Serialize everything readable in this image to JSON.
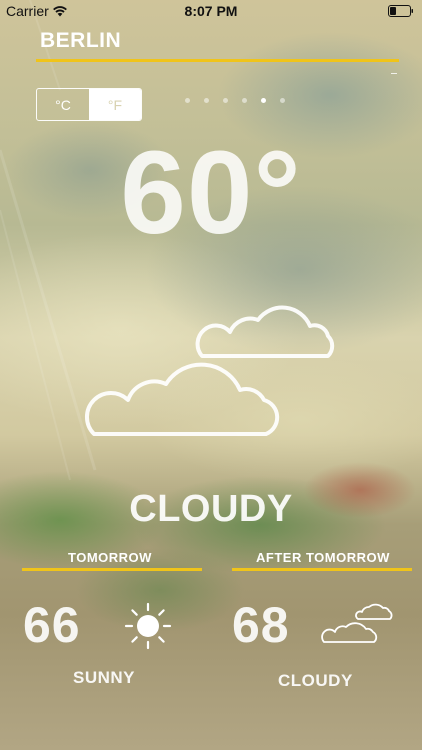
{
  "status_bar": {
    "carrier": "Carrier",
    "time": "8:07 PM"
  },
  "city": {
    "name": "BERLIN"
  },
  "unit_toggle": {
    "celsius_label": "°C",
    "fahrenheit_label": "°F",
    "selected": "°F"
  },
  "pager": {
    "total_pages": 6,
    "active_page": 5
  },
  "current": {
    "temperature": "60°",
    "condition": "CLOUDY",
    "icon": "clouds-icon"
  },
  "forecast": {
    "tomorrow": {
      "label": "TOMORROW",
      "temperature": "66",
      "condition": "SUNNY",
      "icon": "sun-icon"
    },
    "after_tomorrow": {
      "label": "AFTER TOMORROW",
      "temperature": "68",
      "condition": "CLOUDY",
      "icon": "clouds-icon"
    }
  },
  "colors": {
    "accent": "#f0c419",
    "text": "#ffffff"
  }
}
